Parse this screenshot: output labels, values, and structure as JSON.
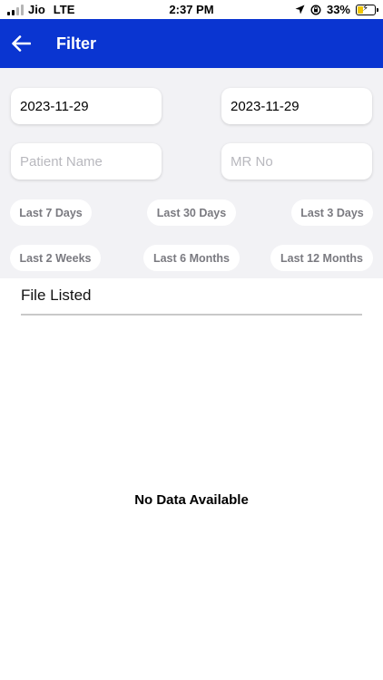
{
  "status_bar": {
    "carrier": "Jio",
    "network": "LTE",
    "time": "2:37 PM",
    "battery": "33%",
    "battery_level": 0.33,
    "battery_color": "#f2c500"
  },
  "header": {
    "title": "Filter",
    "background": "#0a35d1",
    "back_icon": "arrow-left-icon"
  },
  "filters": {
    "from_date": "2023-11-29",
    "to_date": "2023-11-29",
    "patient_name_placeholder": "Patient Name",
    "mr_no_placeholder": "MR No",
    "quick_ranges": [
      "Last 7 Days",
      "Last 30 Days",
      "Last 3 Days",
      "Last 2 Weeks",
      "Last 6 Months",
      "Last 12 Months"
    ]
  },
  "list": {
    "title": "File Listed",
    "empty_message": "No Data Available"
  }
}
